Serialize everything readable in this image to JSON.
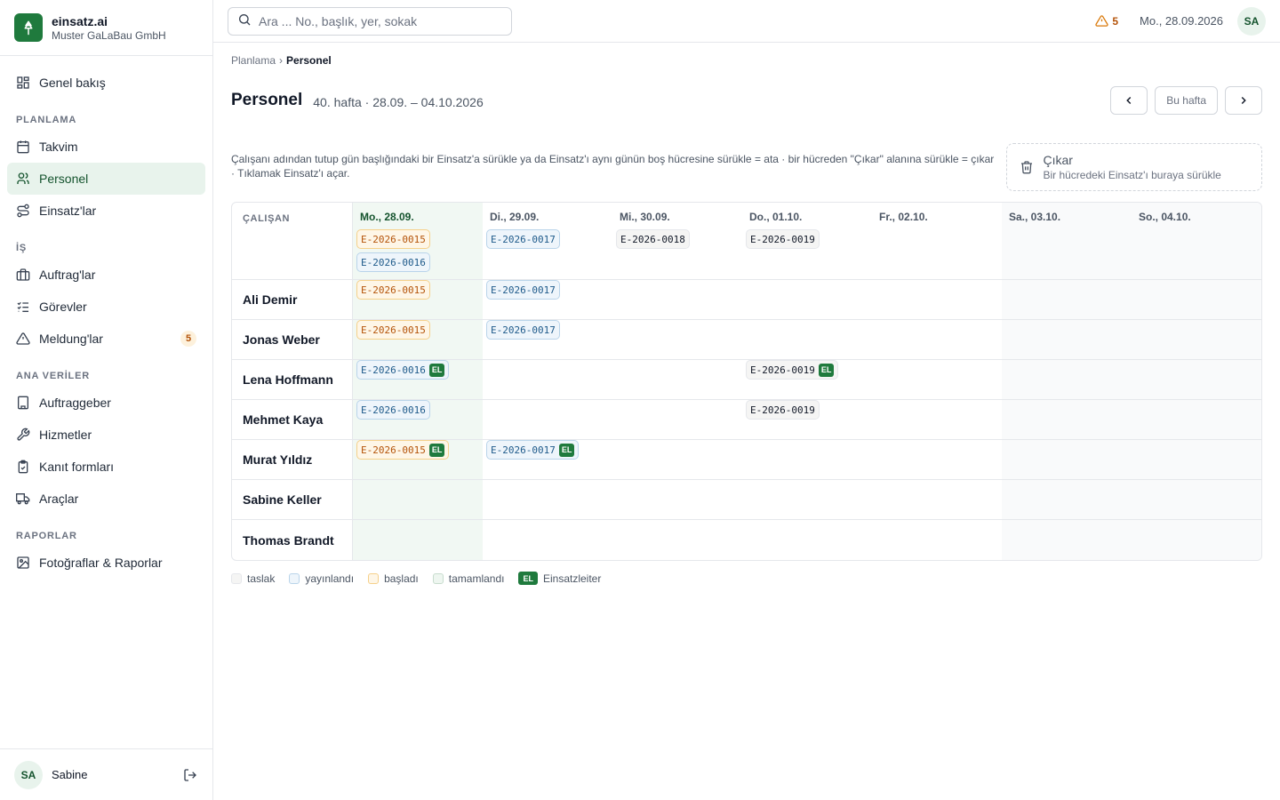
{
  "brand": {
    "name": "einsatz.ai",
    "company": "Muster GaLaBau GmbH"
  },
  "nav": {
    "overview": "Genel bakış",
    "section_planning": "PLANLAMA",
    "calendar": "Takvim",
    "personnel": "Personel",
    "assignments": "Einsatz'lar",
    "section_work": "İŞ",
    "orders": "Auftrag'lar",
    "tasks": "Görevler",
    "reports": "Meldung'lar",
    "reports_badge": "5",
    "section_master": "ANA VERİLER",
    "clients": "Auftraggeber",
    "services": "Hizmetler",
    "proof_forms": "Kanıt formları",
    "vehicles": "Araçlar",
    "section_reports": "RAPORLAR",
    "photos_reports": "Fotoğraflar & Raporlar"
  },
  "user": {
    "initials": "SA",
    "name": "Sabine"
  },
  "topbar": {
    "search_placeholder": "Ara ... No., başlık, yer, sokak",
    "alert_count": "5",
    "date": "Mo., 28.09.2026"
  },
  "breadcrumb": {
    "parent": "Planlama",
    "sep": "›",
    "current": "Personel"
  },
  "page": {
    "title": "Personel",
    "subtitle": "40. hafta · 28.09. – 04.10.2026",
    "this_week": "Bu hafta",
    "hint": "Çalışanı adından tutup gün başlığındaki bir Einsatz'a sürükle ya da Einsatz'ı aynı günün boş hücresine sürükle = ata · bir hücreden \"Çıkar\" alanına sürükle = çıkar · Tıklamak Einsatz'ı açar.",
    "remove_title": "Çıkar",
    "remove_sub": "Bir hücredeki Einsatz'ı buraya sürükle"
  },
  "grid": {
    "employee_header": "ÇALIŞAN",
    "days": [
      "Mo., 28.09.",
      "Di., 29.09.",
      "Mi., 30.09.",
      "Do., 01.10.",
      "Fr., 02.10.",
      "Sa., 03.10.",
      "So., 04.10."
    ],
    "day_assignments": [
      [
        {
          "id": "E-2026-0015",
          "status": "started"
        },
        {
          "id": "E-2026-0016",
          "status": "published"
        }
      ],
      [
        {
          "id": "E-2026-0017",
          "status": "published"
        }
      ],
      [
        {
          "id": "E-2026-0018",
          "status": "draft"
        }
      ],
      [
        {
          "id": "E-2026-0019",
          "status": "draft"
        }
      ],
      [],
      [],
      []
    ],
    "el_label": "EL",
    "rows": [
      {
        "name": "Ali Demir",
        "cells": [
          [
            {
              "id": "E-2026-0015",
              "status": "started"
            }
          ],
          [
            {
              "id": "E-2026-0017",
              "status": "published"
            }
          ],
          [],
          [],
          [],
          [],
          []
        ]
      },
      {
        "name": "Jonas Weber",
        "cells": [
          [
            {
              "id": "E-2026-0015",
              "status": "started"
            }
          ],
          [
            {
              "id": "E-2026-0017",
              "status": "published"
            }
          ],
          [],
          [],
          [],
          [],
          []
        ]
      },
      {
        "name": "Lena Hoffmann",
        "cells": [
          [
            {
              "id": "E-2026-0016",
              "status": "published",
              "el": true
            }
          ],
          [],
          [],
          [
            {
              "id": "E-2026-0019",
              "status": "draft",
              "el": true
            }
          ],
          [],
          [],
          []
        ]
      },
      {
        "name": "Mehmet Kaya",
        "cells": [
          [
            {
              "id": "E-2026-0016",
              "status": "published"
            }
          ],
          [],
          [],
          [
            {
              "id": "E-2026-0019",
              "status": "draft"
            }
          ],
          [],
          [],
          []
        ]
      },
      {
        "name": "Murat Yıldız",
        "cells": [
          [
            {
              "id": "E-2026-0015",
              "status": "started",
              "el": true
            }
          ],
          [
            {
              "id": "E-2026-0017",
              "status": "published",
              "el": true
            }
          ],
          [],
          [],
          [],
          [],
          []
        ]
      },
      {
        "name": "Sabine Keller",
        "cells": [
          [],
          [],
          [],
          [],
          [],
          [],
          []
        ]
      },
      {
        "name": "Thomas Brandt",
        "cells": [
          [],
          [],
          [],
          [],
          [],
          [],
          []
        ]
      }
    ]
  },
  "legend": {
    "draft": "taslak",
    "published": "yayınlandı",
    "started": "başladı",
    "done": "tamamlandı",
    "el_badge": "EL",
    "el_text": "Einsatzleiter"
  },
  "colors": {
    "brand": "#1f7a3d",
    "started": "#b45309",
    "published": "#1e5a8a",
    "today_bg": "#f1f8f3"
  }
}
